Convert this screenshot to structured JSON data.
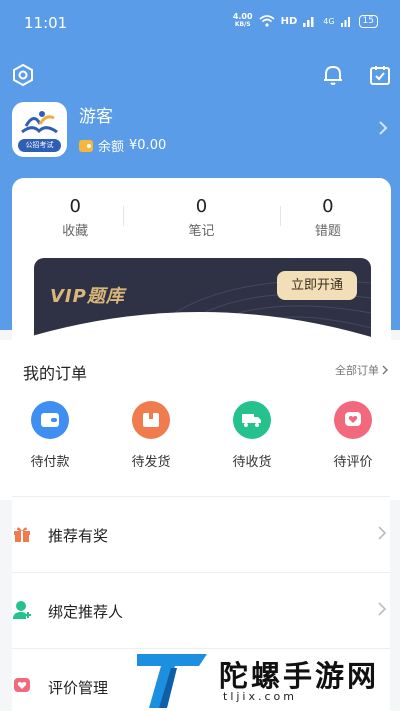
{
  "status_bar": {
    "time": "11:01",
    "net_speed_value": "4.00",
    "net_speed_unit": "KB/S",
    "hd_label": "HD",
    "signal_label": "4G",
    "battery": "15"
  },
  "header": {
    "settings_icon": "hexagon-settings-icon",
    "notification_icon": "bell-icon",
    "checkin_icon": "calendar-check-icon"
  },
  "profile": {
    "username": "游客",
    "avatar_tag": "公招考试",
    "balance_label": "余额",
    "balance_value": "¥0.00"
  },
  "stats": [
    {
      "count": "0",
      "label": "收藏"
    },
    {
      "count": "0",
      "label": "笔记"
    },
    {
      "count": "0",
      "label": "错题"
    }
  ],
  "vip": {
    "title": "VIP题库",
    "button": "立即开通"
  },
  "orders": {
    "title": "我的订单",
    "all_link": "全部订单",
    "items": [
      {
        "label": "待付款",
        "icon": "wallet-icon",
        "color": "#3f8ef2"
      },
      {
        "label": "待发货",
        "icon": "package-icon",
        "color": "#f07b4e"
      },
      {
        "label": "待收货",
        "icon": "truck-icon",
        "color": "#25c28e"
      },
      {
        "label": "待评价",
        "icon": "heart-chat-icon",
        "color": "#f2697d"
      }
    ]
  },
  "menu": [
    {
      "label": "推荐有奖",
      "icon": "gift-icon",
      "color": "#f07b4e"
    },
    {
      "label": "绑定推荐人",
      "icon": "user-plus-icon",
      "color": "#25c28e"
    },
    {
      "label": "评价管理",
      "icon": "heart-chat-icon",
      "color": "#f2697d"
    }
  ],
  "watermark": {
    "text": "陀螺手游网",
    "url": "tljix.com"
  }
}
